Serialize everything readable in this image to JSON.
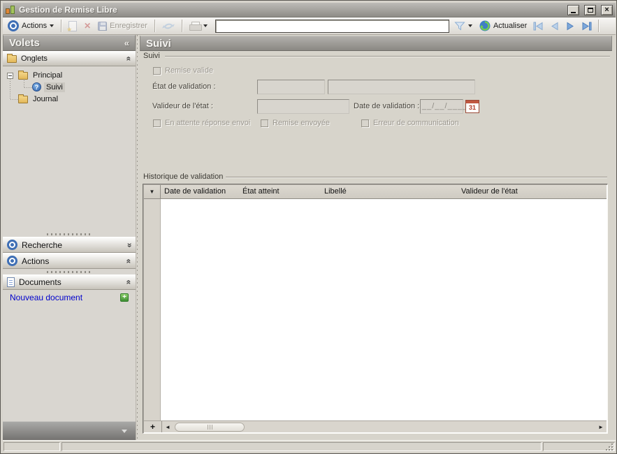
{
  "window": {
    "title": "Gestion de Remise Libre"
  },
  "toolbar": {
    "actions_label": "Actions",
    "save_label": "Enregistrer",
    "search": {
      "value": "",
      "placeholder": ""
    },
    "refresh_label": "Actualiser"
  },
  "sidebar": {
    "title": "Volets",
    "onglets_label": "Onglets",
    "tree_items": [
      {
        "label": "Principal"
      },
      {
        "label": "Suivi"
      },
      {
        "label": "Journal"
      }
    ],
    "recherche_label": "Recherche",
    "actions_label": "Actions",
    "documents_label": "Documents",
    "new_document_label": "Nouveau document"
  },
  "main": {
    "header": "Suivi",
    "suivi_group": {
      "label": "Suivi",
      "remise_valide": "Remise valide",
      "etat_validation": "État de validation :",
      "valideur_etat": "Valideur de l'état :",
      "date_validation": "Date de validation :",
      "date_mask": "__/__/____",
      "cb_attente": "En attente réponse envoi",
      "cb_envoyee": "Remise envoyée",
      "cb_erreur": "Erreur de communication"
    },
    "historique_group": {
      "label": "Historique de validation",
      "columns": [
        "Date de validation",
        "État atteint",
        "Libellé",
        "Valideur de l'état"
      ],
      "rows": []
    }
  },
  "icons": {
    "collapse_left": "«",
    "chevron_double": "«",
    "grid_indicator": "▼",
    "scroll_left": "◄",
    "scroll_right": "►",
    "add_row": "+",
    "new_doc_plus": "+",
    "help_glyph": "?",
    "calendar_day": "31",
    "close_glyph": "×"
  },
  "colors": {
    "accent_blue": "#3f6fb5",
    "link_blue": "#0000cc",
    "folder_yellow": "#e9c470",
    "green_plus": "#3e8f33",
    "disabled_text": "#9b978f",
    "header_gray": "#8a8883"
  }
}
